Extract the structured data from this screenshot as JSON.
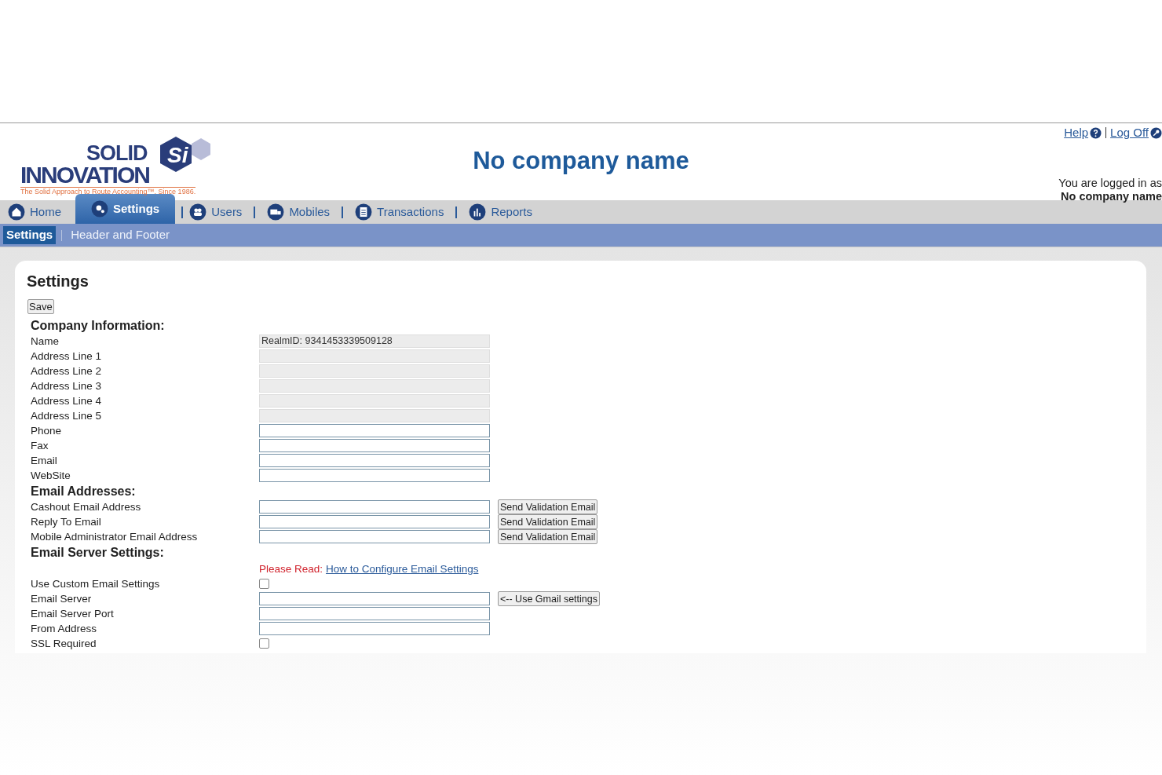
{
  "logo": {
    "word1": "SOLID",
    "word2": "INNOVATION",
    "mark": "Si",
    "tagline": "The Solid Approach to Route Accounting™. Since 1986."
  },
  "company_title": "No company name",
  "top_links": [
    "Help",
    "Log Off"
  ],
  "login": {
    "caption": "You are logged in as",
    "user": "No company name"
  },
  "nav": [
    {
      "label": "Home",
      "selected": false
    },
    {
      "label": "Settings",
      "selected": true
    },
    {
      "label": "Users",
      "selected": false
    },
    {
      "label": "Mobiles",
      "selected": false
    },
    {
      "label": "Transactions",
      "selected": false
    },
    {
      "label": "Reports",
      "selected": false
    }
  ],
  "subnav": [
    {
      "label": "Settings",
      "selected": true
    },
    {
      "label": "Header and Footer",
      "selected": false
    }
  ],
  "page_title": "Settings",
  "save_button": "Save",
  "sections": [
    {
      "title": "Company Information:",
      "rows": [
        {
          "kind": "field",
          "label": "Name",
          "value": "RealmID: 9341453339509128",
          "disabled": true
        },
        {
          "kind": "field",
          "label": "Address Line 1",
          "disabled": true
        },
        {
          "kind": "field",
          "label": "Address Line 2",
          "disabled": true
        },
        {
          "kind": "field",
          "label": "Address Line 3",
          "disabled": true
        },
        {
          "kind": "field",
          "label": "Address Line 4",
          "disabled": true
        },
        {
          "kind": "field",
          "label": "Address Line 5",
          "disabled": true
        },
        {
          "kind": "field",
          "label": "Phone",
          "disabled": false
        },
        {
          "kind": "field",
          "label": "Fax",
          "disabled": false
        },
        {
          "kind": "field",
          "label": "Email",
          "disabled": false
        },
        {
          "kind": "field",
          "label": "WebSite",
          "disabled": false
        }
      ]
    },
    {
      "title": "Email Addresses:",
      "rows": [
        {
          "kind": "field",
          "label": "Cashout Email Address",
          "disabled": false,
          "button": "Send Validation Email"
        },
        {
          "kind": "field",
          "label": "Reply To Email",
          "disabled": false,
          "button": "Send Validation Email"
        },
        {
          "kind": "field",
          "label": "Mobile Administrator Email Address",
          "disabled": false,
          "button": "Send Validation Email"
        }
      ]
    },
    {
      "title": "Email Server Settings:",
      "rows": [
        {
          "kind": "note",
          "prefix": "Please Read:",
          "link": "How to Configure Email Settings"
        },
        {
          "kind": "checkbox",
          "label": "Use Custom Email Settings",
          "checked": false
        },
        {
          "kind": "field",
          "label": "Email Server",
          "disabled": false,
          "button": "<-- Use Gmail settings"
        },
        {
          "kind": "field",
          "label": "Email Server Port",
          "disabled": false
        },
        {
          "kind": "field",
          "label": "From Address",
          "disabled": false
        },
        {
          "kind": "checkbox",
          "label": "SSL Required",
          "checked": false
        }
      ]
    }
  ]
}
